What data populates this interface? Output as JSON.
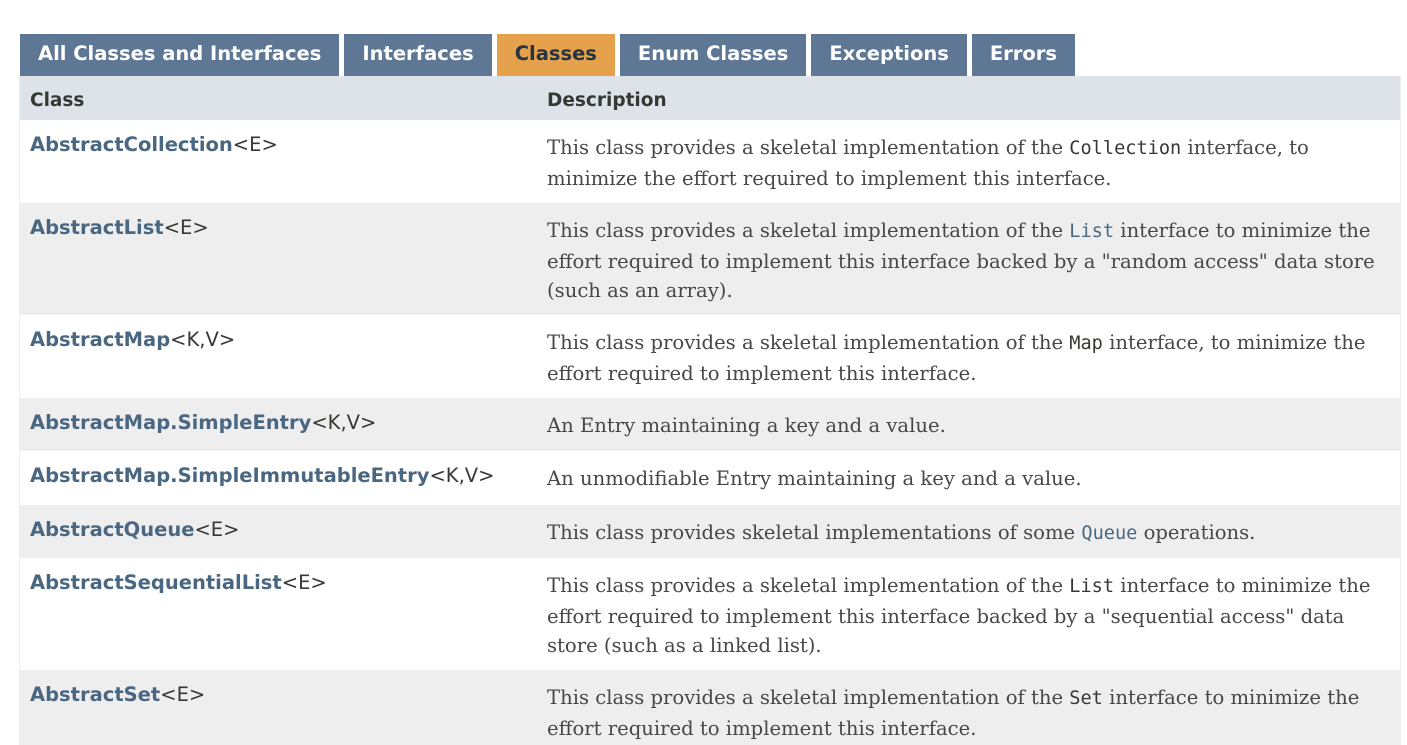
{
  "tabs": [
    {
      "label": "All Classes and Interfaces",
      "active": false
    },
    {
      "label": "Interfaces",
      "active": false
    },
    {
      "label": "Classes",
      "active": true
    },
    {
      "label": "Enum Classes",
      "active": false
    },
    {
      "label": "Exceptions",
      "active": false
    },
    {
      "label": "Errors",
      "active": false
    }
  ],
  "table": {
    "header": {
      "class": "Class",
      "description": "Description"
    },
    "rows": [
      {
        "name": "AbstractCollection",
        "params": "<E>",
        "desc_before": "This class provides a skeletal implementation of the ",
        "code": "Collection",
        "code_link": false,
        "desc_after": " interface, to minimize the effort required to implement this interface."
      },
      {
        "name": "AbstractList",
        "params": "<E>",
        "desc_before": "This class provides a skeletal implementation of the ",
        "code": "List",
        "code_link": true,
        "desc_after": " interface to minimize the effort required to implement this interface backed by a \"random access\" data store (such as an array)."
      },
      {
        "name": "AbstractMap",
        "params": "<K,V>",
        "desc_before": "This class provides a skeletal implementation of the ",
        "code": "Map",
        "code_link": false,
        "desc_after": " interface, to minimize the effort required to implement this interface."
      },
      {
        "name": "AbstractMap.SimpleEntry",
        "params": "<K,V>",
        "desc_before": "An Entry maintaining a key and a value.",
        "code": "",
        "code_link": false,
        "desc_after": ""
      },
      {
        "name": "AbstractMap.SimpleImmutableEntry",
        "params": "<K,V>",
        "desc_before": "An unmodifiable Entry maintaining a key and a value.",
        "code": "",
        "code_link": false,
        "desc_after": ""
      },
      {
        "name": "AbstractQueue",
        "params": "<E>",
        "desc_before": "This class provides skeletal implementations of some ",
        "code": "Queue",
        "code_link": true,
        "desc_after": " operations."
      },
      {
        "name": "AbstractSequentialList",
        "params": "<E>",
        "desc_before": "This class provides a skeletal implementation of the ",
        "code": "List",
        "code_link": false,
        "desc_after": " interface to minimize the effort required to implement this interface backed by a \"sequential access\" data store (such as a linked list)."
      },
      {
        "name": "AbstractSet",
        "params": "<E>",
        "desc_before": "This class provides a skeletal implementation of the ",
        "code": "Set",
        "code_link": false,
        "desc_after": " interface to minimize the effort required to implement this interface."
      }
    ]
  },
  "colors": {
    "tab_bg": "#5e7794",
    "tab_active_bg": "#e5a14c",
    "header_bg": "#dee3e9",
    "link": "#4a6782",
    "row_alt": "#eeeeef"
  }
}
